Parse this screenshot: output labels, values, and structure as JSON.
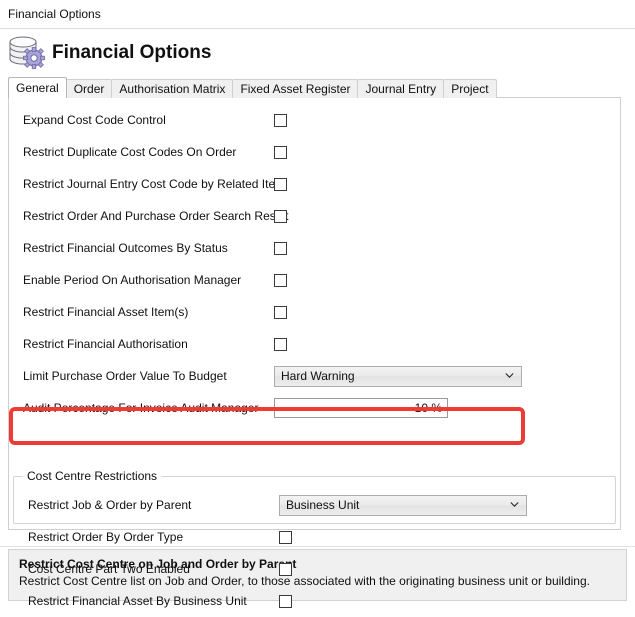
{
  "window": {
    "title": "Financial Options"
  },
  "header": {
    "title": "Financial Options",
    "icon": "coins-gear-icon"
  },
  "tabs": [
    {
      "label": "General",
      "active": true
    },
    {
      "label": "Order",
      "active": false
    },
    {
      "label": "Authorisation Matrix",
      "active": false
    },
    {
      "label": "Fixed Asset Register",
      "active": false
    },
    {
      "label": "Journal Entry",
      "active": false
    },
    {
      "label": "Project",
      "active": false
    }
  ],
  "general": {
    "options": [
      {
        "label": "Expand Cost Code Control",
        "type": "checkbox",
        "checked": false
      },
      {
        "label": "Restrict Duplicate Cost Codes On Order",
        "type": "checkbox",
        "checked": false
      },
      {
        "label": "Restrict Journal Entry Cost Code by Related Item",
        "type": "checkbox",
        "checked": false
      },
      {
        "label": "Restrict Order And Purchase Order Search Result",
        "type": "checkbox",
        "checked": false
      },
      {
        "label": "Restrict Financial Outcomes By Status",
        "type": "checkbox",
        "checked": false
      },
      {
        "label": "Enable Period On Authorisation Manager",
        "type": "checkbox",
        "checked": false
      },
      {
        "label": "Restrict Financial Asset Item(s)",
        "type": "checkbox",
        "checked": false
      },
      {
        "label": "Restrict Financial Authorisation",
        "type": "checkbox",
        "checked": false
      },
      {
        "label": "Limit Purchase Order Value To Budget",
        "type": "combo",
        "value": "Hard Warning"
      },
      {
        "label": "Audit Percentage For Invoice Audit Manager",
        "type": "number",
        "value": "10 %"
      }
    ]
  },
  "cost_centre_restrictions": {
    "legend": "Cost Centre Restrictions",
    "options": [
      {
        "label": "Restrict Job & Order by Parent",
        "type": "combo",
        "value": "Business Unit",
        "highlighted": true
      },
      {
        "label": "Restrict Order By Order Type",
        "type": "checkbox",
        "checked": false
      },
      {
        "label": "Cost Centre Part Two Enabled",
        "type": "checkbox",
        "checked": false
      },
      {
        "label": "Restrict Financial Asset By Business Unit",
        "type": "checkbox",
        "checked": false
      }
    ]
  },
  "help": {
    "title": "Restrict Cost Centre on Job and Order by Parent",
    "body": "Restrict Cost Centre list on Job and Order, to those associated with the originating business unit or building."
  },
  "colors": {
    "highlight": "#ee3b33",
    "panel_bg": "#ffffff",
    "help_bg": "#f0f0f0",
    "tab_inactive": "#f0f0f0"
  }
}
